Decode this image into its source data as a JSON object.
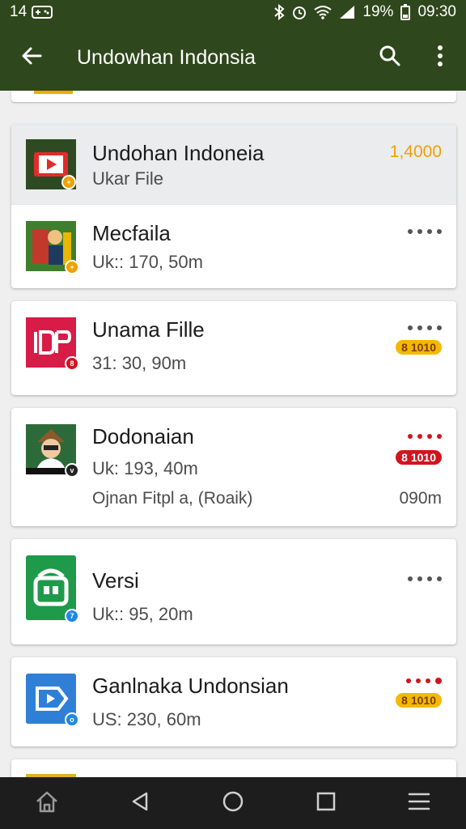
{
  "status_bar": {
    "left_text": "14",
    "battery": "19%",
    "time": "09:30"
  },
  "app_bar": {
    "title": "Undowhan Indonsia",
    "back_icon": "arrow-left-icon",
    "search_icon": "search-icon",
    "more_icon": "more-vert-icon"
  },
  "items": [
    {
      "title": "Undohan Indoneia",
      "subtitle": "Ukar File",
      "count": "1,4000",
      "count_color": "#f0a000",
      "highlight": true,
      "icon": "play-icon"
    },
    {
      "title": "Mecfaila",
      "subtitle": "Uk:: 170, 50m",
      "dots_color": "#555555",
      "icon": "photo-icon"
    },
    {
      "title": "Unama Fille",
      "subtitle": "31: 30, 90m",
      "dots_color": "#555555",
      "pill": "8 1010",
      "pill_bg": "#f5b800",
      "pill_color": "#7a3d00",
      "icon": "dp-icon"
    },
    {
      "title": "Dodonaian",
      "subtitle": "Uk: 193, 40m",
      "detail": "Ojnan Fitpl a, (Roaik)",
      "detail_right": "090m",
      "dots_color": "#d0151e",
      "pill": "8 1010",
      "pill_bg": "#d0151e",
      "pill_color": "#ffffff",
      "icon": "person-icon"
    },
    {
      "title": "Versi",
      "subtitle": "Uk:: 95, 20m",
      "dots_color": "#555555",
      "icon": "android-icon"
    },
    {
      "title": "Ganlnaka Undonsian",
      "subtitle": "US: 230, 60m",
      "dots_color": "#d0151e",
      "pill": "8 1010",
      "pill_bg": "#f5b800",
      "pill_color": "#7a3d00",
      "icon": "play-outline-icon"
    }
  ],
  "nav_bar": {
    "home_icon": "home-icon",
    "back_icon": "triangle-back-icon",
    "circle_icon": "circle-home-icon",
    "square_icon": "square-recents-icon",
    "menu_icon": "menu-icon"
  },
  "colors": {
    "app_bar": "#2f471c",
    "nav_bar": "#1d1d1d",
    "accent_orange": "#f0a000",
    "accent_red": "#d0151e"
  }
}
